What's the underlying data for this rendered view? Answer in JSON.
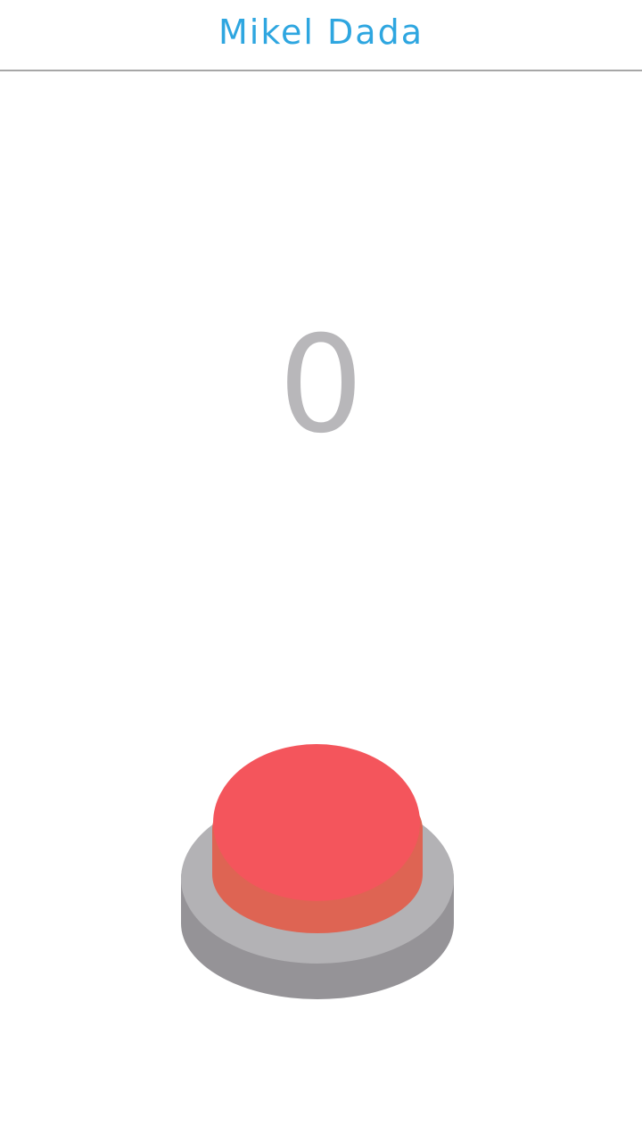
{
  "header": {
    "title": "Mikel Dada",
    "title_color": "#2ea6e0"
  },
  "counter": {
    "value": "0",
    "color": "#b8b7ba"
  },
  "big_button": {
    "icon": "big-red-button-icon",
    "top_color": "#f4555c",
    "side_color": "#de6453",
    "base_top_color": "#b3b2b5",
    "base_side_color": "#959397"
  }
}
